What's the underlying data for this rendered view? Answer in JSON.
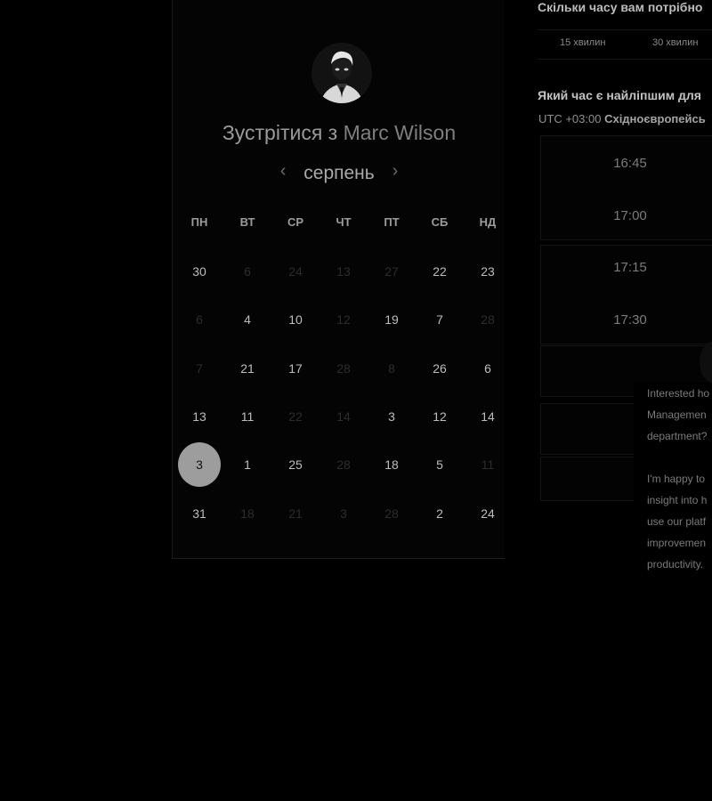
{
  "calendar": {
    "title_prefix": "Зустрітися з",
    "person_name": "Marc Wilson",
    "month": "серпень",
    "prev_arrow": "‹",
    "next_arrow": "›",
    "weekdays": [
      "ПН",
      "ВТ",
      "СР",
      "ЧТ",
      "ПТ",
      "СБ",
      "НД"
    ],
    "weeks": [
      [
        "30",
        "6",
        "24",
        "13",
        "27",
        "22",
        "23"
      ],
      [
        "6",
        "4",
        "10",
        "12",
        "19",
        "7",
        "28"
      ],
      [
        "7",
        "21",
        "17",
        "28",
        "8",
        "26",
        "6"
      ],
      [
        "13",
        "11",
        "22",
        "14",
        "3",
        "12",
        "14"
      ],
      [
        "3",
        "1",
        "25",
        "28",
        "18",
        "5",
        "11"
      ],
      [
        "31",
        "18",
        "21",
        "3",
        "28",
        "2",
        "24"
      ]
    ],
    "selected_day": "3"
  },
  "duration": {
    "question": "Скільки часу вам потрібно",
    "options": [
      "15 хвилин",
      "30 хвилин"
    ]
  },
  "time": {
    "question": "Який час є найліпшим для",
    "timezone_offset": "UTC +03:00",
    "timezone_name": "Східноєвропейсь",
    "slots": [
      "16:45",
      "17:00",
      "17:15",
      "17:30"
    ]
  },
  "chat": {
    "paragraph1": [
      "Interested ho",
      "Managemen",
      "department?"
    ],
    "paragraph2": [
      "I'm happy to",
      "insight into h",
      "use our platf",
      "improvemen",
      "productivity."
    ]
  },
  "colors": {
    "background": "#000000",
    "selected_day_bg": "#9d9d9d"
  }
}
